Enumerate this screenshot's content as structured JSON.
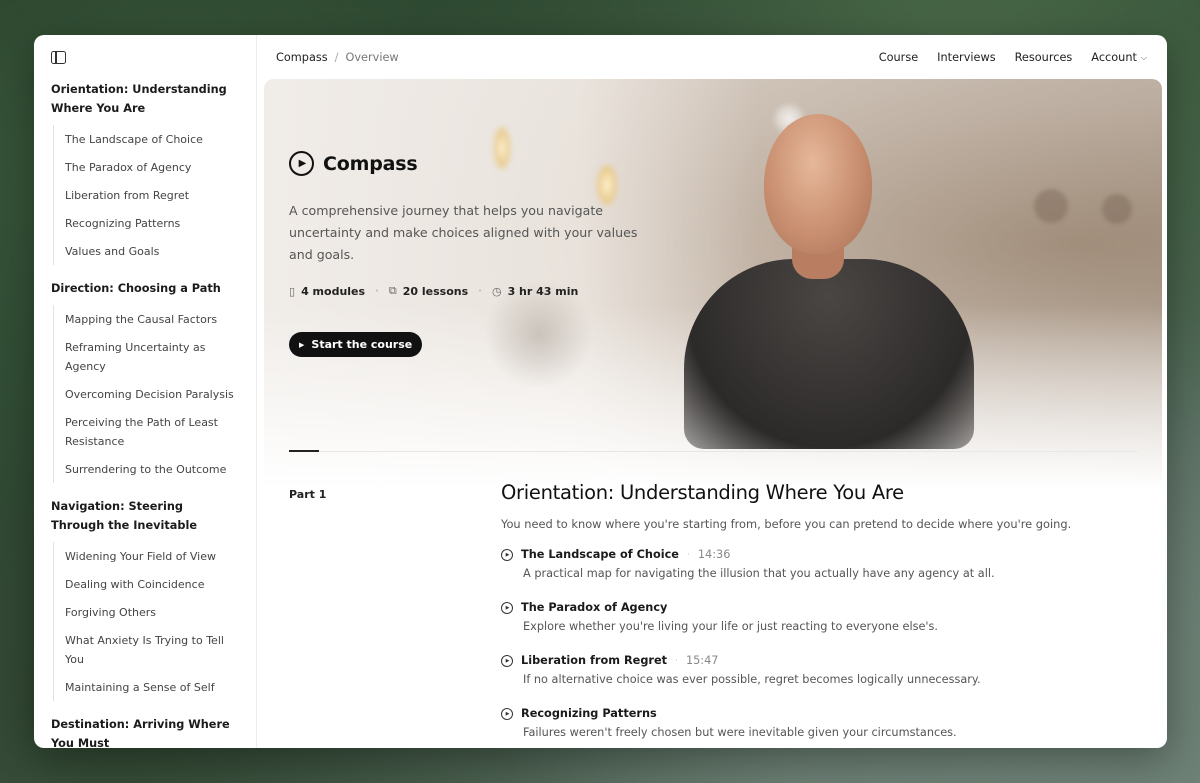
{
  "sidebar": {
    "toggle_icon": "sidebar-toggle-icon",
    "sections": [
      {
        "title": "Orientation: Understanding Where You Are",
        "items": [
          "The Landscape of Choice",
          "The Paradox of Agency",
          "Liberation from Regret",
          "Recognizing Patterns",
          "Values and Goals"
        ]
      },
      {
        "title": "Direction: Choosing a Path",
        "items": [
          "Mapping the Causal Factors",
          "Reframing Uncertainty as Agency",
          "Overcoming Decision Paralysis",
          "Perceiving the Path of Least Resistance",
          "Surrendering to the Outcome"
        ]
      },
      {
        "title": "Navigation: Steering Through the Inevitable",
        "items": [
          "Widening Your Field of View",
          "Dealing with Coincidence",
          "Forgiving Others",
          "What Anxiety Is Trying to Tell You",
          "Maintaining a Sense of Self"
        ]
      },
      {
        "title": "Destination: Arriving Where You Must",
        "items": []
      }
    ]
  },
  "breadcrumb": {
    "root": "Compass",
    "separator": "/",
    "current": "Overview"
  },
  "nav": {
    "course": "Course",
    "interviews": "Interviews",
    "resources": "Resources",
    "account": "Account"
  },
  "hero": {
    "brand": "Compass",
    "description": "A comprehensive journey that helps you navigate uncertainty and make choices aligned with your values and goals.",
    "stats": {
      "modules": "4 modules",
      "lessons": "20 lessons",
      "duration": "3 hr 43 min"
    },
    "start_label": "Start the course"
  },
  "part": {
    "label": "Part 1",
    "title": "Orientation: Understanding Where You Are",
    "description": "You need to know where you're starting from, before you can pretend to decide where you're going.",
    "lessons": [
      {
        "title": "The Landscape of Choice",
        "duration": "14:36",
        "description": "A practical map for navigating the illusion that you actually have any agency at all."
      },
      {
        "title": "The Paradox of Agency",
        "duration": "",
        "description": "Explore whether you're living your life or just reacting to everyone else's."
      },
      {
        "title": "Liberation from Regret",
        "duration": "15:47",
        "description": "If no alternative choice was ever possible, regret becomes logically unnecessary."
      },
      {
        "title": "Recognizing Patterns",
        "duration": "",
        "description": "Failures weren't freely chosen but were inevitable given your circumstances."
      }
    ]
  },
  "colors": {
    "accent": "#111111",
    "button_text": "#ffffff",
    "muted_text": "#555555"
  }
}
